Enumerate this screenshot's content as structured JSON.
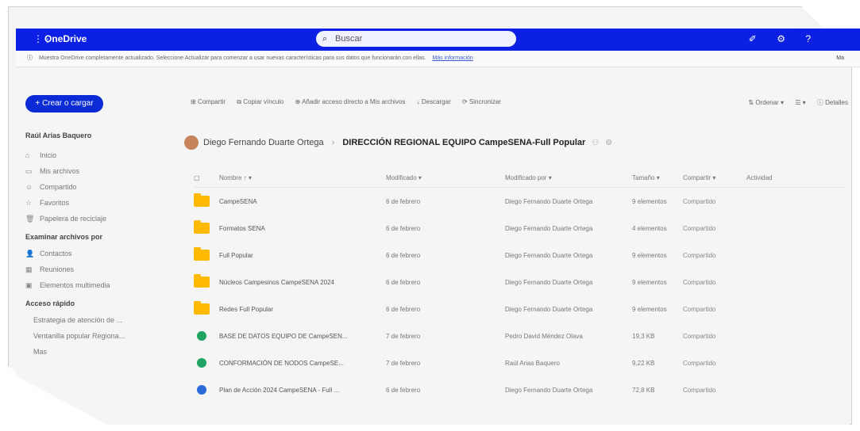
{
  "app": {
    "name": "OneDrive"
  },
  "topbar": {
    "search_placeholder": "Buscar",
    "icons": [
      "megaphone-icon",
      "settings-icon",
      "help-icon"
    ]
  },
  "notice": {
    "text": "Muestra OneDrive completamente actualizado. Seleccione Actualizar para comenzar a usar nuevas características para sus datos que funcionarán con ellas.",
    "link": "Más información",
    "right": "Ma"
  },
  "sidebar": {
    "create_label": "+ Crear o cargar",
    "owner": "Raúl Arias Baquero",
    "items": [
      {
        "label": "Inicio",
        "icon": "home-icon"
      },
      {
        "label": "Mis archivos",
        "icon": "folder-icon"
      },
      {
        "label": "Compartido",
        "icon": "people-icon"
      },
      {
        "label": "Favoritos",
        "icon": "star-icon"
      },
      {
        "label": "Papelera de reciclaje",
        "icon": "trash-icon"
      }
    ],
    "browse_section": "Examinar archivos por",
    "browse_items": [
      {
        "label": "Contactos",
        "icon": "person-icon"
      },
      {
        "label": "Reuniones",
        "icon": "calendar-icon"
      },
      {
        "label": "Elementos multimedia",
        "icon": "media-icon"
      }
    ],
    "quick_section": "Acceso rápido",
    "quick_items": [
      {
        "label": "Estrategia de atención de ..."
      },
      {
        "label": "Ventanilla popular Regiona..."
      },
      {
        "label": "Mas"
      }
    ]
  },
  "commandbar": {
    "share": "Compartir",
    "copy_link": "Copiar vínculo",
    "add_shortcut": "Añadir acceso directo a Mis archivos",
    "download": "Descargar",
    "sync": "Sincronizar",
    "sort": "Ordenar",
    "details": "Detalles"
  },
  "breadcrumb": {
    "owner": "Diego Fernando Duarte Ortega",
    "folder": "DIRECCIÓN REGIONAL EQUIPO CampeSENA-Full Popular"
  },
  "table": {
    "headers": [
      "Nombre",
      "Modificado",
      "Modificado por",
      "Tamaño",
      "Compartir",
      "Actividad"
    ],
    "rows": [
      {
        "type": "folder",
        "name": "CampeSENA",
        "modified": "6 de febrero",
        "by": "Diego Fernando Duarte Ortega",
        "size": "9 elementos",
        "share": "Compartido"
      },
      {
        "type": "folder",
        "name": "Formatos SENA",
        "modified": "6 de febrero",
        "by": "Diego Fernando Duarte Ortega",
        "size": "4 elementos",
        "share": "Compartido"
      },
      {
        "type": "folder",
        "name": "Full Popular",
        "modified": "6 de febrero",
        "by": "Diego Fernando Duarte Ortega",
        "size": "9 elementos",
        "share": "Compartido"
      },
      {
        "type": "folder",
        "name": "Núcleos Campesinos CampeSENA 2024",
        "modified": "6 de febrero",
        "by": "Diego Fernando Duarte Ortega",
        "size": "9 elementos",
        "share": "Compartido"
      },
      {
        "type": "folder",
        "name": "Redes Full Popular",
        "modified": "6 de febrero",
        "by": "Diego Fernando Duarte Ortega",
        "size": "9 elementos",
        "share": "Compartido"
      },
      {
        "type": "sheet",
        "name": "BASE DE DATOS EQUIPO DE CampeSEN...",
        "modified": "7 de febrero",
        "by": "Pedro David Méndez Olava",
        "size": "19,3 KB",
        "share": "Compartido"
      },
      {
        "type": "sheet",
        "name": "CONFORMACIÓN DE NODOS CampeSE...",
        "modified": "7 de febrero",
        "by": "Raúl Arias Baquero",
        "size": "9,22 KB",
        "share": "Compartido"
      },
      {
        "type": "doc",
        "name": "Plan de Acción 2024 CampeSENA - Full ...",
        "modified": "6 de febrero",
        "by": "Diego Fernando Duarte Ortega",
        "size": "72,8 KB",
        "share": "Compartido"
      }
    ]
  }
}
